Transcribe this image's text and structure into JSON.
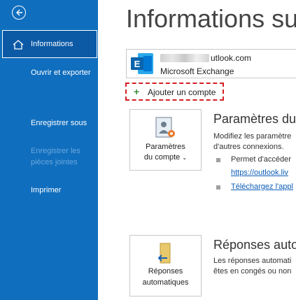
{
  "sidebar": {
    "items": [
      {
        "label": "Informations"
      },
      {
        "label": "Ouvrir et exporter"
      },
      {
        "label": "Enregistrer sous"
      },
      {
        "label": "Enregistrer les pièces jointes"
      },
      {
        "label": "Imprimer"
      }
    ]
  },
  "main": {
    "title": "Informations su",
    "account": {
      "email_visible": "utlook.com",
      "type": "Microsoft Exchange"
    },
    "add_account_label": "Ajouter un compte",
    "account_settings": {
      "button_line1": "Paramètres",
      "button_line2": "du compte",
      "heading": "Paramètres du",
      "desc_line1": "Modifiez les paramètre",
      "desc_line2": "d'autres connexions.",
      "bullet1_text": "Permet d'accéder",
      "bullet1_link": "https://outlook.liv",
      "bullet2_link": "Téléchargez l'appl"
    },
    "auto_replies": {
      "button_line1": "Réponses",
      "button_line2": "automatiques",
      "heading": "Réponses auto",
      "desc_line1": "Les réponses automati",
      "desc_line2": "êtes en congés ou non"
    }
  },
  "colors": {
    "sidebar": "#106ebe",
    "highlight_border": "#d41f24",
    "link": "#0b5db7"
  }
}
